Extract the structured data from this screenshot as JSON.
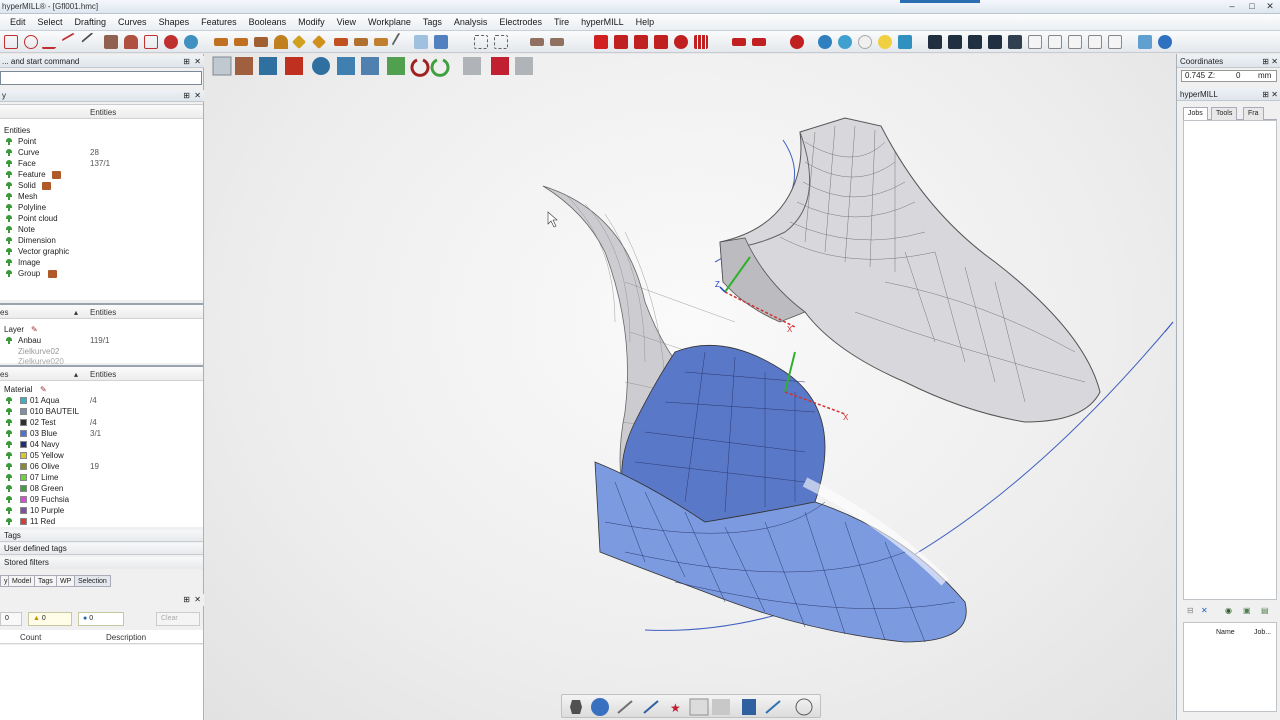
{
  "window": {
    "title": "hyperMILL® - [Gfl001.hmc]"
  },
  "menu": [
    "Edit",
    "Select",
    "Drafting",
    "Curves",
    "Shapes",
    "Features",
    "Booleans",
    "Modify",
    "View",
    "Workplane",
    "Tags",
    "Analysis",
    "Electrodes",
    "Tire",
    "hyperMILL",
    "Help"
  ],
  "left": {
    "cmd_header": "... and start command",
    "entity_panel_header": "y",
    "entities_col": "Entities",
    "entities_title": "Entities",
    "entity_rows": [
      {
        "label": "Point",
        "value": ""
      },
      {
        "label": "Curve",
        "value": "28"
      },
      {
        "label": "Face",
        "value": "137/1"
      },
      {
        "label": "Feature",
        "value": ""
      },
      {
        "label": "Solid",
        "value": ""
      },
      {
        "label": "Mesh",
        "value": ""
      },
      {
        "label": "Polyline",
        "value": ""
      },
      {
        "label": "Point cloud",
        "value": ""
      },
      {
        "label": "Note",
        "value": ""
      },
      {
        "label": "Dimension",
        "value": ""
      },
      {
        "label": "Vector graphic",
        "value": ""
      },
      {
        "label": "Image",
        "value": ""
      },
      {
        "label": "Group",
        "value": ""
      }
    ],
    "layers_header_left": "es",
    "layers_col": "Entities",
    "layer_title": "Layer",
    "layer_rows": [
      {
        "label": "Anbau",
        "value": "119/1"
      },
      {
        "label": "Zielkurve02",
        "value": ""
      },
      {
        "label": "Zielkurve020",
        "value": ""
      }
    ],
    "materials_header_left": "es",
    "materials_col": "Entities",
    "material_title": "Material",
    "material_rows": [
      {
        "label": "01 Aqua",
        "value": "/4",
        "color": "#40b0c0"
      },
      {
        "label": "010 BAUTEIL",
        "value": "",
        "color": "#8090a8"
      },
      {
        "label": "02 Test",
        "value": "/4",
        "color": "#303030"
      },
      {
        "label": "03 Blue",
        "value": "3/1",
        "color": "#5070d8"
      },
      {
        "label": "04 Navy",
        "value": "",
        "color": "#203070"
      },
      {
        "label": "05 Yellow",
        "value": "",
        "color": "#d8c830"
      },
      {
        "label": "06 Olive",
        "value": "19",
        "color": "#8a8a30"
      },
      {
        "label": "07 Lime",
        "value": "",
        "color": "#70d040"
      },
      {
        "label": "08 Green",
        "value": "",
        "color": "#40a040"
      },
      {
        "label": "09 Fuchsia",
        "value": "",
        "color": "#d050d0"
      },
      {
        "label": "10 Purple",
        "value": "",
        "color": "#8050a0"
      },
      {
        "label": "11 Red",
        "value": "",
        "color": "#d04040"
      }
    ],
    "tags_header": "Tags",
    "user_tags": "User defined tags",
    "stored_filters": "Stored filters",
    "filter_tabs": [
      "y",
      "Model",
      "Tags",
      "WP",
      "Selection"
    ],
    "messages": {
      "errors": "0",
      "warnings": "0",
      "infos": "0",
      "clear": "Clear",
      "count_col": "Count",
      "desc_col": "Description"
    }
  },
  "right": {
    "coord_header": "Coordinates",
    "coord_value": "0.745",
    "coord_axis": "Z:",
    "coord_z": "0",
    "coord_unit": "mm",
    "hm_header": "hyperMILL",
    "tabs": [
      "Jobs",
      "Tools",
      "Fra"
    ],
    "list_cols": [
      "Name",
      "Job..."
    ]
  },
  "axes": {
    "z": "Z",
    "x": "X"
  },
  "colors": {
    "accent": "#2a6db0",
    "blue_surface": "#6b8fd8",
    "grey_surface": "#c8c8cc"
  }
}
